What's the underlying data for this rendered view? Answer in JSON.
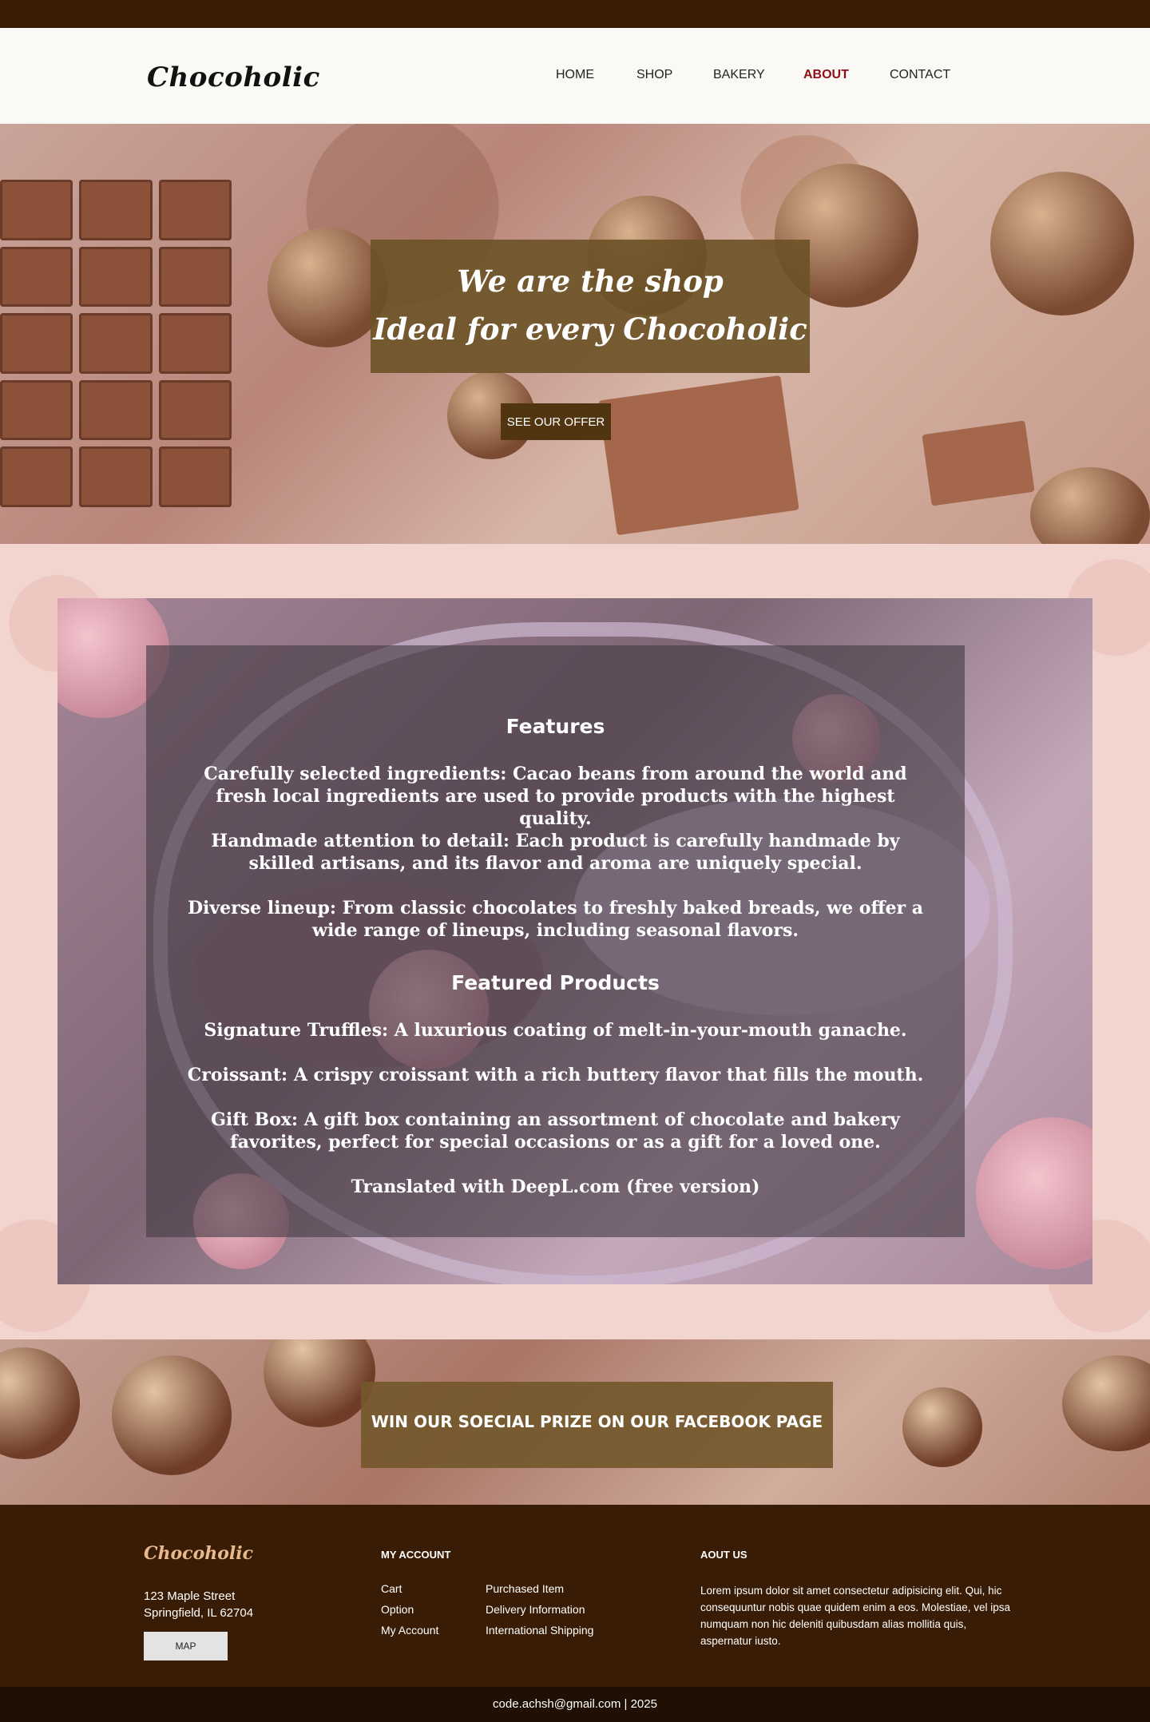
{
  "header": {
    "logo": "Chocoholic",
    "nav": [
      {
        "label": "HOME",
        "active": false
      },
      {
        "label": "SHOP",
        "active": false
      },
      {
        "label": "BAKERY",
        "active": false
      },
      {
        "label": "ABOUT",
        "active": true
      },
      {
        "label": "CONTACT",
        "active": false
      }
    ]
  },
  "hero": {
    "line1": "We are the shop",
    "line2": "Ideal for every Chocoholic",
    "button": "SEE OUR OFFER"
  },
  "features": {
    "heading": "Features",
    "items": [
      "Carefully selected ingredients: Cacao beans from around the world and fresh local ingredients are used to provide products with the highest quality.",
      "Handmade attention to detail: Each product is carefully handmade by skilled artisans, and its flavor and aroma are uniquely special.",
      "Diverse lineup: From classic chocolates to freshly baked breads, we offer a wide range of lineups, including seasonal flavors."
    ],
    "products_heading": "Featured Products",
    "products": [
      "Signature Truffles: A luxurious coating of melt-in-your-mouth ganache.",
      "Croissant: A crispy croissant with a rich buttery flavor that fills the mouth.",
      "Gift Box: A gift box containing an assortment of chocolate and bakery favorites, perfect for special occasions or as a gift for a loved one."
    ],
    "credit": "Translated with DeepL.com (free version)"
  },
  "promo": {
    "text": "WIN OUR SOECIAL PRIZE ON OUR FACEBOOK PAGE"
  },
  "footer": {
    "logo": "Chocoholic",
    "address_line1": "123 Maple Street",
    "address_line2": "Springfield, IL 62704",
    "map_button": "MAP",
    "account_heading": "MY ACCOUNT",
    "account_col1": [
      "Cart",
      "Option",
      "My Account"
    ],
    "account_col2": [
      "Purchased Item",
      "Delivery Information",
      "International Shipping"
    ],
    "about_heading": "AOUT US",
    "about_text": "Lorem ipsum dolor sit amet consectetur adipisicing elit. Qui, hic consequuntur nobis quae quidem enim a eos. Molestiae, vel ipsa numquam non hic deleniti quibusdam alias mollitia quis, aspernatur iusto.",
    "bottom": "code.achsh@gmail.com | 2025"
  },
  "colors": {
    "top_bar": "#391c05",
    "active_nav": "#8a1016",
    "hero_box": "#6c5226",
    "footer_logo": "#e9b98e"
  }
}
